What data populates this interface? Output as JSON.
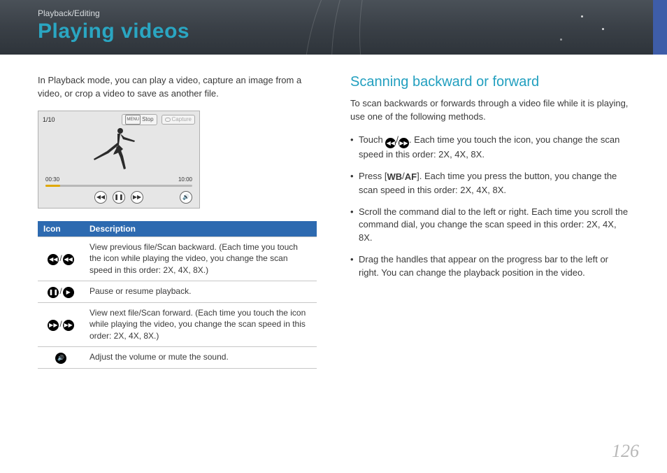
{
  "header": {
    "breadcrumb": "Playback/Editing",
    "title": "Playing videos"
  },
  "left": {
    "intro": "In Playback mode, you can play a video, capture an image from a video, or crop a video to save as another file.",
    "preview": {
      "counter": "1/10",
      "menu_btn": "MENU",
      "stop_label": "Stop",
      "capture_label": "Capture",
      "time_start": "00:30",
      "time_end": "10:00"
    },
    "table": {
      "headers": {
        "icon": "Icon",
        "desc": "Description"
      },
      "rows": [
        {
          "kind": "rewind",
          "desc": "View previous file/Scan backward. (Each time you touch the icon while playing the video, you change the scan speed in this order: 2X, 4X, 8X.)"
        },
        {
          "kind": "pause",
          "desc": "Pause or resume playback."
        },
        {
          "kind": "forward",
          "desc": "View next file/Scan forward. (Each time you touch the icon while playing the video, you change the scan speed in this order: 2X, 4X, 8X.)"
        },
        {
          "kind": "volume",
          "desc": "Adjust the volume or mute the sound."
        }
      ]
    }
  },
  "right": {
    "section_title": "Scanning backward or forward",
    "intro": "To scan backwards or forwards through a video file while it is playing, use one of the following methods.",
    "bullets": [
      {
        "prefix": "Touch ",
        "icon_pair": "rewfwd",
        "suffix": ". Each time you touch the icon, you change the scan speed in this order: 2X, 4X, 8X."
      },
      {
        "prefix": "Press [",
        "icon_pair": "wbaf",
        "suffix": "]. Each time you press the button, you change the scan speed in this order: 2X, 4X, 8X."
      },
      {
        "text": "Scroll the command dial to the left or right. Each time you scroll the command dial, you change the scan speed in this order: 2X, 4X, 8X."
      },
      {
        "text": "Drag the handles that appear on the progress bar to the left or right. You can change the playback position in the video."
      }
    ]
  },
  "page_number": "126"
}
